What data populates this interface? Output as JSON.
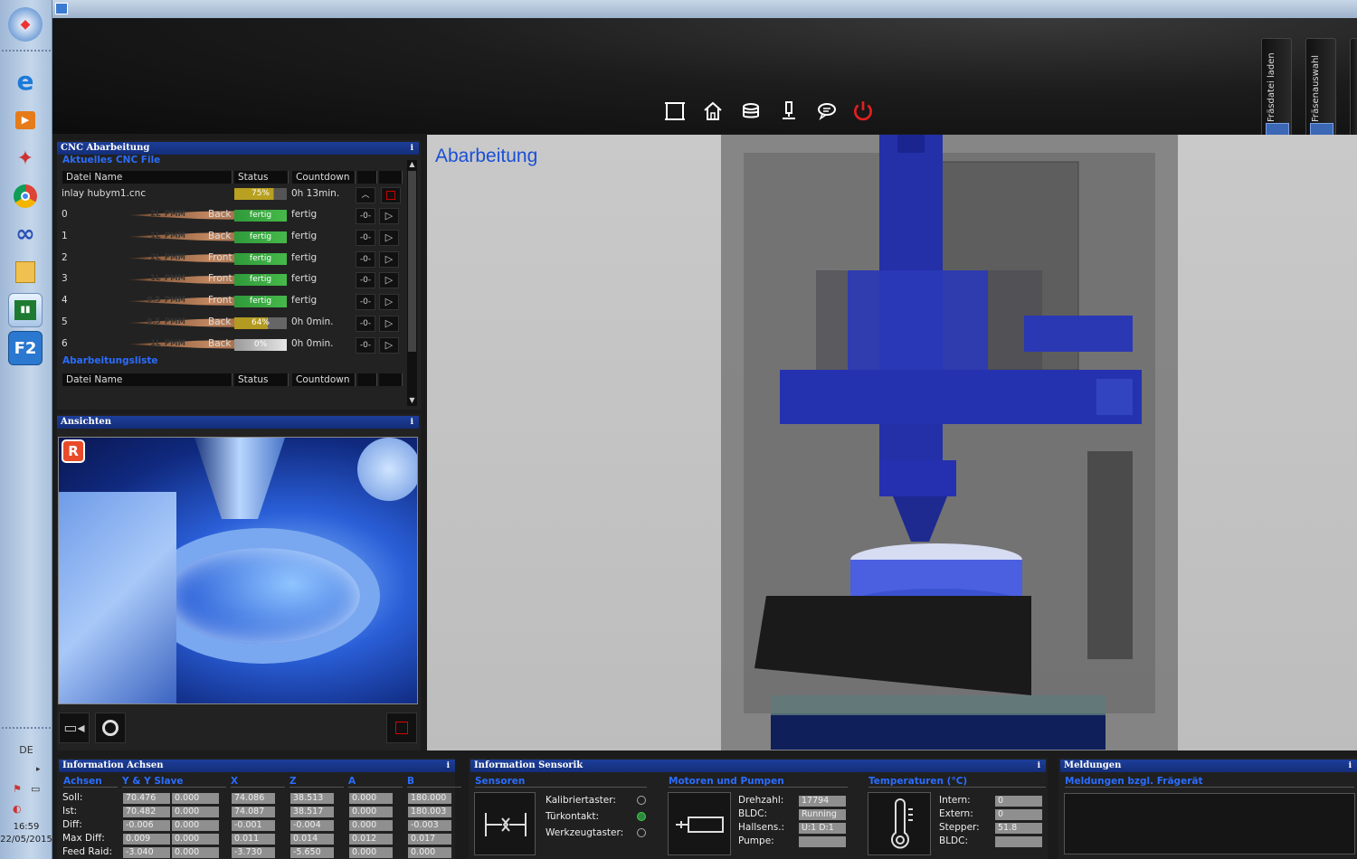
{
  "taskbar": {
    "apps": [
      "windows-start-icon",
      "internet-explorer-icon",
      "media-player-icon",
      "satellite-app-icon",
      "chrome-icon",
      "infinity-app-icon",
      "file-explorer-icon",
      "chart-app-icon",
      "f2-app-icon"
    ],
    "lang": "DE",
    "time": "16:59",
    "date": "22/05/2015"
  },
  "toolbar": {
    "icons": [
      "frame-icon",
      "home-icon",
      "stack-icon",
      "probe-icon",
      "chat-icon",
      "power-icon"
    ],
    "side_tabs": [
      "Fräsdatei laden",
      "Fräsenauswahl"
    ]
  },
  "cnc": {
    "panel_title": "CNC Abarbeitung",
    "info": "i",
    "current_label": "Aktuelles CNC File",
    "col_file": "Datei Name",
    "col_status": "Status",
    "col_countdown": "Countdown",
    "file_name": "inlay hubym1.cnc",
    "file_progress": "75%",
    "file_countdown": "0h 13min.",
    "rows": [
      {
        "idx": "0",
        "tool": "2L_PMM",
        "side": "Back",
        "status": "fertig",
        "countdown": "fertig"
      },
      {
        "idx": "1",
        "tool": "1L_PMM",
        "side": "Back",
        "status": "fertig",
        "countdown": "fertig"
      },
      {
        "idx": "2",
        "tool": "2L_PMM",
        "side": "Front",
        "status": "fertig",
        "countdown": "fertig"
      },
      {
        "idx": "3",
        "tool": "1L_PMM",
        "side": "Front",
        "status": "fertig",
        "countdown": "fertig"
      },
      {
        "idx": "4",
        "tool": "0.5_PMM",
        "side": "Front",
        "status": "fertig",
        "countdown": "fertig"
      },
      {
        "idx": "5",
        "tool": "0.5_PMM",
        "side": "Back",
        "status": "64%",
        "countdown": "0h 0min."
      },
      {
        "idx": "6",
        "tool": "1L_PMM",
        "side": "Back",
        "status": "0%",
        "countdown": "0h 0min."
      }
    ],
    "queue_label": "Abarbeitungsliste"
  },
  "views": {
    "panel_title": "Ansichten",
    "info": "i"
  },
  "main": {
    "title": "Abarbeitung"
  },
  "axes": {
    "panel_title": "Information Achsen",
    "info": "i",
    "headers": [
      "Achsen",
      "Y & Y Slave",
      "X",
      "Z",
      "A",
      "B"
    ],
    "rows": [
      {
        "label": "Soll:",
        "values": [
          "70.476",
          "0.000",
          "74.086",
          "38.513",
          "0.000",
          "180.000"
        ]
      },
      {
        "label": "Ist:",
        "values": [
          "70.482",
          "0.000",
          "74.087",
          "38.517",
          "0.000",
          "180.003"
        ]
      },
      {
        "label": "Diff:",
        "values": [
          "-0.006",
          "0.000",
          "-0.001",
          "-0.004",
          "0.000",
          "-0.003"
        ]
      },
      {
        "label": "Max Diff:",
        "values": [
          "0.009",
          "0.000",
          "0.011",
          "0.014",
          "0.012",
          "0.017"
        ]
      },
      {
        "label": "Feed Raid:",
        "values": [
          "-3.040",
          "0.000",
          "-3.730",
          "-5.650",
          "0.000",
          "0.000"
        ]
      }
    ]
  },
  "sensors": {
    "panel_title": "Information Sensorik",
    "info": "i",
    "sensors_label": "Sensoren",
    "sensor_items": [
      "Kalibriertaster:",
      "Türkontakt:",
      "Werkzeugtaster:"
    ],
    "motors_label": "Motoren und Pumpen",
    "motor_items": [
      {
        "label": "Drehzahl:",
        "value": "17794"
      },
      {
        "label": "BLDC:",
        "value": "Running"
      },
      {
        "label": "Hallsens.:",
        "value": "U:1 D:1"
      },
      {
        "label": "Pumpe:",
        "value": ""
      }
    ],
    "temp_label": "Temperaturen (°C)",
    "temp_items": [
      {
        "label": "Intern:",
        "value": "0"
      },
      {
        "label": "Extern:",
        "value": "0"
      },
      {
        "label": "Stepper:",
        "value": "51.8"
      },
      {
        "label": "BLDC:",
        "value": ""
      }
    ]
  },
  "messages": {
    "panel_title": "Meldungen",
    "info": "i",
    "sub_label": "Meldungen bzgl. Frägerät"
  }
}
